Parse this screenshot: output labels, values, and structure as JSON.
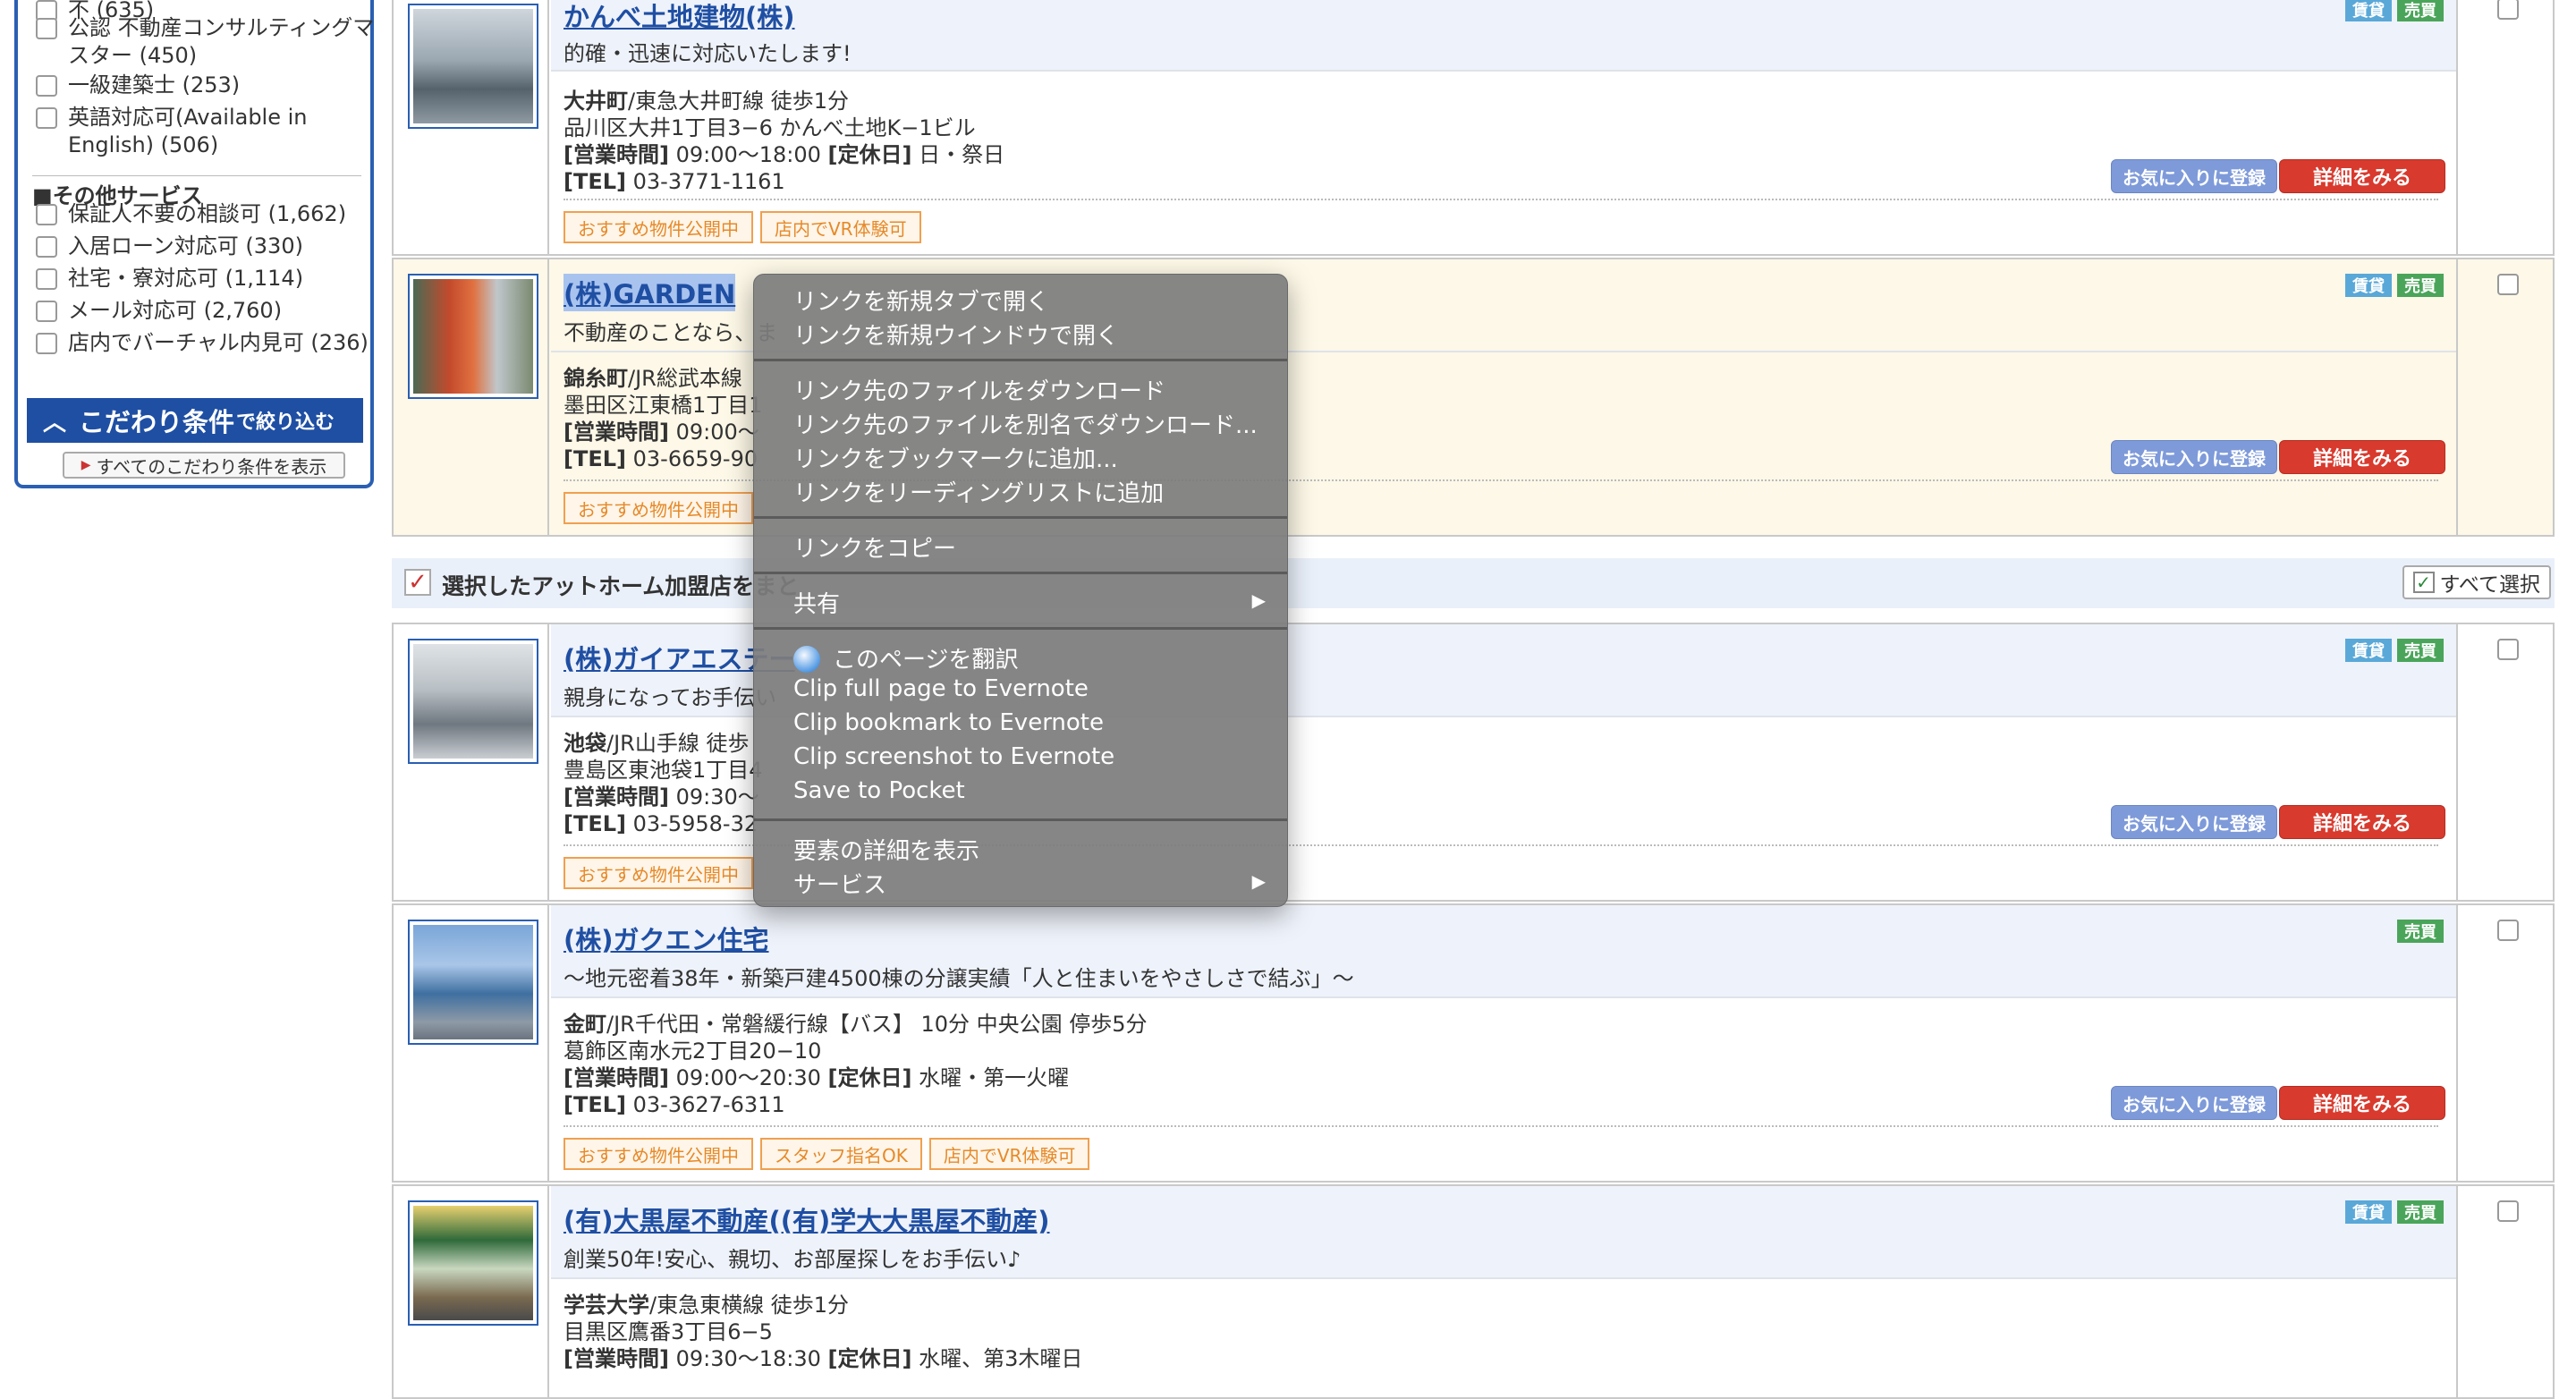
{
  "sidebar": {
    "items_top": [
      {
        "label": "不 (635)"
      },
      {
        "label": "公認 不動産コンサルティングマスター (450)"
      },
      {
        "label": "一級建築士 (253)"
      },
      {
        "label": "英語対応可(Available in English) (506)"
      }
    ],
    "other_heading": "■その他サービス",
    "other_items": [
      {
        "label": "保証人不要の相談可 (1,662)"
      },
      {
        "label": "入居ローン対応可 (330)"
      },
      {
        "label": "社宅・寮対応可 (1,114)"
      },
      {
        "label": "メール対応可 (2,760)"
      },
      {
        "label": "店内でバーチャル内見可 (236)"
      }
    ],
    "kodawari_main": "こだわり条件",
    "kodawari_small": "で絞り込む",
    "show_all": "すべてのこだわり条件を表示"
  },
  "listings": [
    {
      "title": "かんべ土地建物(株)",
      "catch": "的確・迅速に対応いたします!",
      "station": "大井町",
      "line": "/東急大井町線 徒歩1分",
      "address": "品川区大井1丁目3−6 かんべ土地K−1ビル",
      "hours_label": "[営業時間]",
      "hours": "09:00〜18:00",
      "holiday_label": "[定休日]",
      "holiday": "日・祭日",
      "tel_label": "[TEL]",
      "tel": "03-3771-1161",
      "tags": [
        "賃貸",
        "売買"
      ],
      "badges": [
        "おすすめ物件公開中",
        "店内でVR体験可"
      ]
    },
    {
      "title": "(株)GARDEN",
      "catch": "不動産のことなら、ま",
      "station": "錦糸町",
      "line": "/JR総武本線",
      "address": "墨田区江東橋1丁目1",
      "hours_label": "[営業時間]",
      "hours": "09:00〜",
      "tel_label": "[TEL]",
      "tel": "03-6659-90",
      "tags": [
        "賃貸",
        "売買"
      ],
      "badges": [
        "おすすめ物件公開中"
      ]
    },
    {
      "title": "(株)ガイアエステー",
      "catch": "親身になってお手伝い",
      "station": "池袋",
      "line": "/JR山手線 徒歩",
      "address": "豊島区東池袋1丁目4",
      "hours_label": "[営業時間]",
      "hours": "09:30〜",
      "tel_label": "[TEL]",
      "tel": "03-5958-32",
      "tags": [
        "賃貸",
        "売買"
      ],
      "badges": [
        "おすすめ物件公開中"
      ]
    },
    {
      "title": "(株)ガクエン住宅",
      "catch": "〜地元密着38年・新築戸建4500棟の分譲実績「人と住まいをやさしさで結ぶ」〜",
      "station": "金町",
      "line": "/JR千代田・常磐緩行線【バス】 10分 中央公園 停歩5分",
      "address": "葛飾区南水元2丁目20−10",
      "hours_label": "[営業時間]",
      "hours": "09:00〜20:30",
      "holiday_label": "[定休日]",
      "holiday": "水曜・第一火曜",
      "tel_label": "[TEL]",
      "tel": "03-3627-6311",
      "tags": [
        "売買"
      ],
      "badges": [
        "おすすめ物件公開中",
        "スタッフ指名OK",
        "店内でVR体験可"
      ]
    },
    {
      "title": "(有)大黒屋不動産((有)学大大黒屋不動産)",
      "catch": "創業50年!安心、親切、お部屋探しをお手伝い♪",
      "station": "学芸大学",
      "line": "/東急東横線 徒歩1分",
      "address": "目黒区鷹番3丁目6−5",
      "hours_label": "[営業時間]",
      "hours": "09:30〜18:30",
      "holiday_label": "[定休日]",
      "holiday": "水曜、第3木曜日",
      "tags": [
        "賃貸",
        "売買"
      ]
    }
  ],
  "buttons": {
    "fav": "お気に入りに登録",
    "detail": "詳細をみる"
  },
  "selbar": {
    "text": "選択したアットホーム加盟店をまと",
    "select_all": "すべて選択"
  },
  "context_menu": {
    "group1": [
      "リンクを新規タブで開く",
      "リンクを新規ウインドウで開く"
    ],
    "group2": [
      "リンク先のファイルをダウンロード",
      "リンク先のファイルを別名でダウンロード...",
      "リンクをブックマークに追加...",
      "リンクをリーディングリストに追加"
    ],
    "copy": "リンクをコピー",
    "share": "共有",
    "translate": "このページを翻訳",
    "group5": [
      "Clip full page to Evernote",
      "Clip bookmark to Evernote",
      "Clip screenshot to Evernote",
      "Save to Pocket"
    ],
    "inspect": "要素の詳細を表示",
    "services": "サービス"
  },
  "colors": {
    "link": "#1f4fa3",
    "accent_blue": "#2a5fb3",
    "detail_red": "#d83a2e",
    "tag_chintai": "#5aa8d8",
    "tag_baibai": "#4aa55a"
  }
}
